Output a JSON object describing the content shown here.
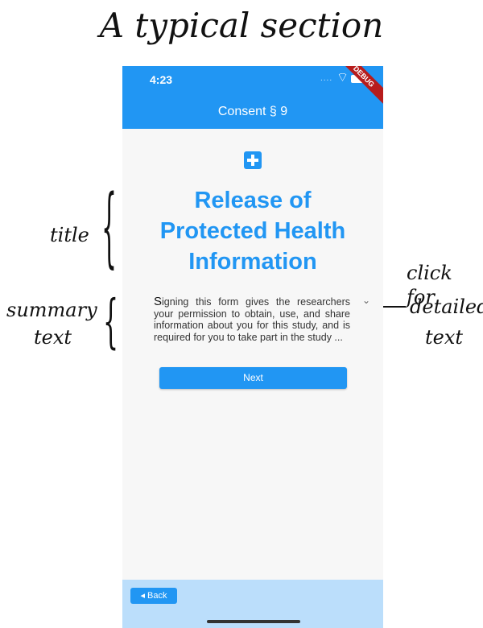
{
  "heading": "A typical section",
  "status_bar": {
    "time": "4:23",
    "signal": "....",
    "debug_label": "DEBUG"
  },
  "app_bar": {
    "title": "Consent § 9"
  },
  "section": {
    "title_lines": [
      "Release of",
      "Protected Health",
      "Information"
    ],
    "summary_first_letter": "S",
    "summary_rest": "igning this form gives the researchers your permission to obtain, use, and share information about you for this study, and is required for you to take part in the study ..."
  },
  "buttons": {
    "next": "Next",
    "back": "◂ Back"
  },
  "annotations": {
    "title_label": "title",
    "summary_label_line1": "summary",
    "summary_label_line2": "text",
    "click_label_line1": "click for",
    "click_label_line2": "detailed",
    "click_label_line3": "text"
  },
  "icons": [
    "plus-icon",
    "wifi-icon",
    "battery-icon",
    "chevron-down-icon"
  ],
  "colors": {
    "primary": "#2196f3",
    "bottom_bar": "#bbdefb",
    "debug_ribbon": "#b71c1c"
  }
}
